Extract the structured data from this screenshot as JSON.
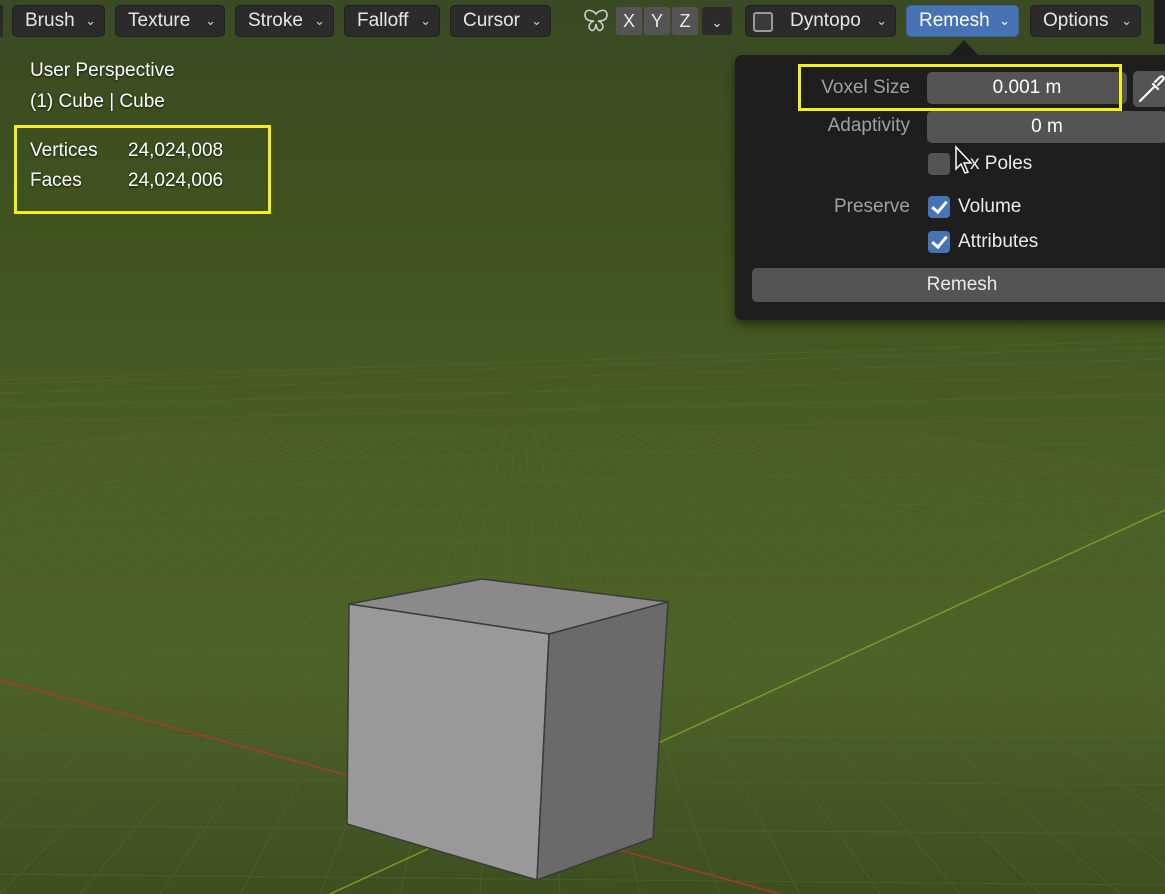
{
  "header": {
    "menus": [
      {
        "label": "Brush"
      },
      {
        "label": "Texture"
      },
      {
        "label": "Stroke"
      },
      {
        "label": "Falloff"
      },
      {
        "label": "Cursor"
      }
    ],
    "symmetry": {
      "x": "X",
      "y": "Y",
      "z": "Z"
    },
    "dyntopo": {
      "label": "Dyntopo",
      "checked": false
    },
    "remesh": {
      "label": "Remesh",
      "active": true
    },
    "options": {
      "label": "Options"
    }
  },
  "overlay": {
    "view_name": "User Perspective",
    "object_name": "(1) Cube | Cube",
    "stats": {
      "vertices_label": "Vertices",
      "vertices_value": "24,024,008",
      "faces_label": "Faces",
      "faces_value": "24,024,006"
    }
  },
  "remesh_panel": {
    "voxel_size_label": "Voxel Size",
    "voxel_size_value": "0.001 m",
    "adaptivity_label": "Adaptivity",
    "adaptivity_value": "0 m",
    "fix_poles_label": "Fix Poles",
    "fix_poles_visible": "x Poles",
    "fix_poles_checked": false,
    "preserve_label": "Preserve",
    "volume_label": "Volume",
    "volume_checked": true,
    "attributes_label": "Attributes",
    "attributes_checked": true,
    "remesh_button_label": "Remesh"
  },
  "colors": {
    "highlight": "#f5f01b",
    "accent_blue": "#4772b3",
    "x_axis": "#b8352f",
    "y_axis": "#7fa12b"
  },
  "icons": [
    "chevron-down-icon",
    "symmetry-butterfly-icon",
    "eyedropper-icon",
    "mouse-cursor-icon"
  ]
}
